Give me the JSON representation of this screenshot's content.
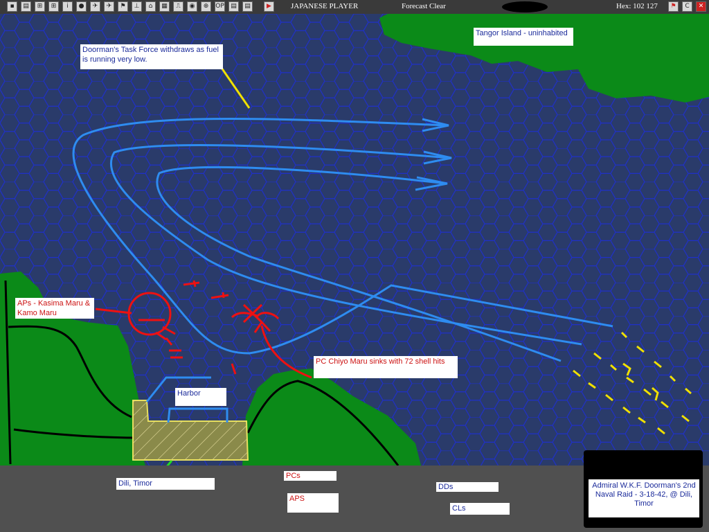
{
  "toolbar": {
    "player_label": "JAPANESE PLAYER",
    "weather_label": "Forecast Clear",
    "hex_label": "Hex: 102 127",
    "buttons": [
      "▪",
      "▤",
      "⊞",
      "⊞",
      "i",
      "●",
      "✈",
      "✈",
      "⚑",
      "⊥",
      "⌂",
      "▦",
      "⎍",
      "◉",
      "⊕",
      "OP",
      "▤",
      "▤",
      "▶"
    ],
    "right_buttons": [
      "⚑",
      "C",
      "✕"
    ]
  },
  "annotations": {
    "task_force": "Doorman's Task Force withdraws as fuel is running very low.",
    "island": "Tangor Island - uninhabited",
    "aps": "APs - Kasima Maru & Kamo Maru",
    "chiyo": "PC Chiyo Maru sinks with 72 shell hits",
    "harbor": "Harbor",
    "dili": "Dili, Timor"
  },
  "legend": {
    "pcs": "PCs",
    "aps": "APS",
    "dds": "DDs",
    "cls": "CLs"
  },
  "title": "Admiral W.K.F. Doorman's 2nd Naval Raid - 3-18-42, @ Dili, Timor",
  "colors": {
    "sea": "#2a3b6a",
    "hex_line": "#1f30c8",
    "land": "#0b8a18",
    "friendly_path": "#2e8cf0",
    "enemy": "#ee1111",
    "dd_cl": "#f0e000"
  }
}
